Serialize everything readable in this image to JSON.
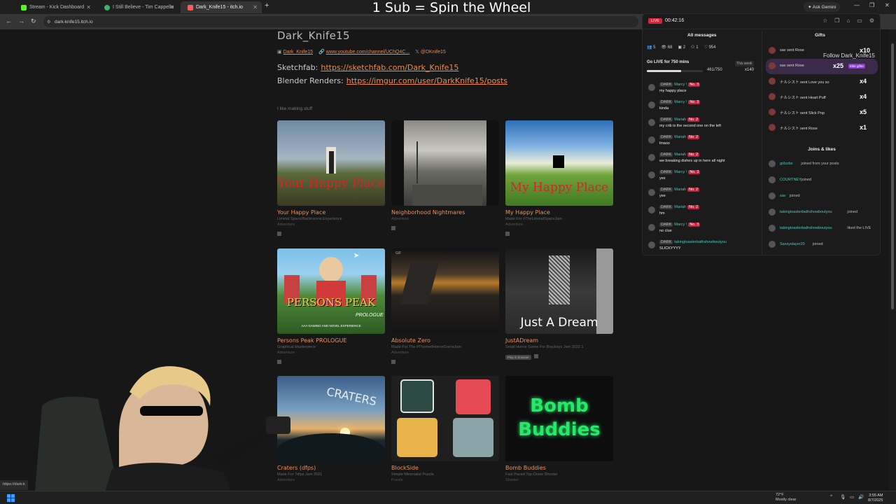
{
  "browser": {
    "tabs": [
      {
        "label": "Stream - Kick Dashboard",
        "color": "#53fc18"
      },
      {
        "label": "I Still Believe - Tim Cappello",
        "color": "#3bb36b"
      },
      {
        "label": "Dark_Knife15 - itch.io",
        "color": "#fa5c5c"
      }
    ],
    "new_tab": "+",
    "gemini": "✦ Ask Gemini",
    "url": "dark-knife15.itch.io",
    "status_url": "https://dark-k"
  },
  "overlay": {
    "title": "1 Sub = Spin the Wheel"
  },
  "profile": {
    "name": "Dark_Knife15",
    "link_name": "Dark_Knife15",
    "link_youtube": "www.youtube.com/channel/UChQ4C...",
    "link_x": "@DKnife15",
    "sketchfab_label": "Sketchfab:",
    "sketchfab_url": "https://sketchfab.com/Dark_Knife15",
    "renders_label": "Blender Renders:",
    "renders_url": "https://imgur.com/user/DarkKnife15/posts",
    "tagline": "I like making stuff"
  },
  "games": [
    {
      "title": "Your Happy Place",
      "desc": "Liminal Space/Backrooms Experience",
      "genre": "Adventure",
      "overlay": "Your Happy Place"
    },
    {
      "title": "Neighborhood Nightmares",
      "desc": "",
      "genre": "Adventure",
      "overlay": ""
    },
    {
      "title": "My Happy Place",
      "desc": "Made For #TheLiminalSpaceJam",
      "genre": "Adventure",
      "overlay": "My Happy Place"
    },
    {
      "title": "Persons Peak PROLOGUE",
      "desc": "Graphical Masterpiece",
      "genre": "Adventure",
      "overlay": "PERSONS PEAK",
      "sub": "AAA GAMING AND NOVEL EXPERIENCE",
      "tag": "PROLOGUE"
    },
    {
      "title": "Absolute Zero",
      "desc": "Made For The #ThemedHorrorGameJam",
      "genre": "Adventure",
      "overlay": "",
      "gif": "GIF"
    },
    {
      "title": "JustADream",
      "desc": "Small Horror Game For Brackeys Jam 2022.1",
      "genre": "",
      "overlay": "Just A Dream",
      "badge": "Play in browser"
    },
    {
      "title": "Craters (dfps)",
      "desc": "Made For 7dfps Jam 2021",
      "genre": "Adventure",
      "overlay": "CRATERS"
    },
    {
      "title": "BlockSide",
      "desc": "Simple Minimalist Puzzle",
      "genre": "Puzzle",
      "overlay": ""
    },
    {
      "title": "Bomb Buddies",
      "desc": "Fast Paced Top-Down Shooter",
      "genre": "Shooter",
      "overlay": "Bomb Buddies"
    }
  ],
  "stream_panel": {
    "live": "LIVE",
    "timer": "00:42:16",
    "messages_header": "All messages",
    "gifts_header": "Gifts",
    "stats": [
      "5",
      "68",
      "2",
      "1",
      "954"
    ],
    "golive": "Go LIVE for 750 mins",
    "this_week": "This week",
    "progress_text": "461/750",
    "progress": 0.615,
    "coins": "x140",
    "follow_overlay": "Follow Dark_Knife15",
    "chat": [
      {
        "user": "Marcy !",
        "badge": "DARK",
        "rank": "No. 3",
        "text": "my happy place"
      },
      {
        "user": "Marcy !",
        "badge": "DARK",
        "rank": "No. 3",
        "text": "kinda"
      },
      {
        "user": "Mariah",
        "badge": "DARK",
        "rank": "No. 2",
        "text": "my crib is the second one on the left"
      },
      {
        "user": "Mariah",
        "badge": "DARK",
        "rank": "No. 2",
        "text": "lmaoo"
      },
      {
        "user": "Mariah",
        "badge": "DARK",
        "rank": "No. 2",
        "text": "we breaking dishes up in here all night"
      },
      {
        "user": "Marcy !",
        "badge": "DARK",
        "rank": "No. 3",
        "text": "yes"
      },
      {
        "user": "Mariah",
        "badge": "DARK",
        "rank": "No. 2",
        "text": "yee"
      },
      {
        "user": "Mariah",
        "badge": "DARK",
        "rank": "No. 2",
        "text": "hm"
      },
      {
        "user": "Marcy !",
        "badge": "DARK",
        "rank": "No. 3",
        "text": "no clue"
      },
      {
        "user": "takingtoasterbathshowboutyou",
        "badge": "DARK",
        "rank": "",
        "text": "SLICKYYYY"
      }
    ],
    "gifts": [
      {
        "text": "sav sent Rose",
        "count": "x10"
      },
      {
        "text": "sav sent Rose",
        "count": "x25",
        "badge": "Elite gifter"
      },
      {
        "text": "ナルシスト sent Love you so",
        "count": "x4"
      },
      {
        "text": "ナルシスト sent Heart Puff",
        "count": "x4"
      },
      {
        "text": "ナルシスト sent Slick Pop",
        "count": "x5"
      },
      {
        "text": "ナルシスト sent Rose",
        "count": "x1"
      }
    ],
    "joins_header": "Joins & likes",
    "joins": [
      {
        "user": "grilzzbx",
        "action": "joined from your posts"
      },
      {
        "user": "COURTNEY",
        "action": "joined"
      },
      {
        "user": "sav",
        "action": "joined"
      },
      {
        "user": "takingtoasterbathshowboutyou",
        "action": "joined"
      },
      {
        "user": "takingtoasterbathshowboutyou",
        "action": "liked the LIVE"
      },
      {
        "user": "Sassyslayer20",
        "action": "joined"
      }
    ]
  },
  "taskbar": {
    "temp": "72°F",
    "weather": "Mostly clear",
    "time": "3:55 AM",
    "date": "8/7/2025"
  },
  "colors": {
    "accent": "#f08a4b",
    "live": "#e0203a",
    "chat_name": "#4dc9c0"
  }
}
